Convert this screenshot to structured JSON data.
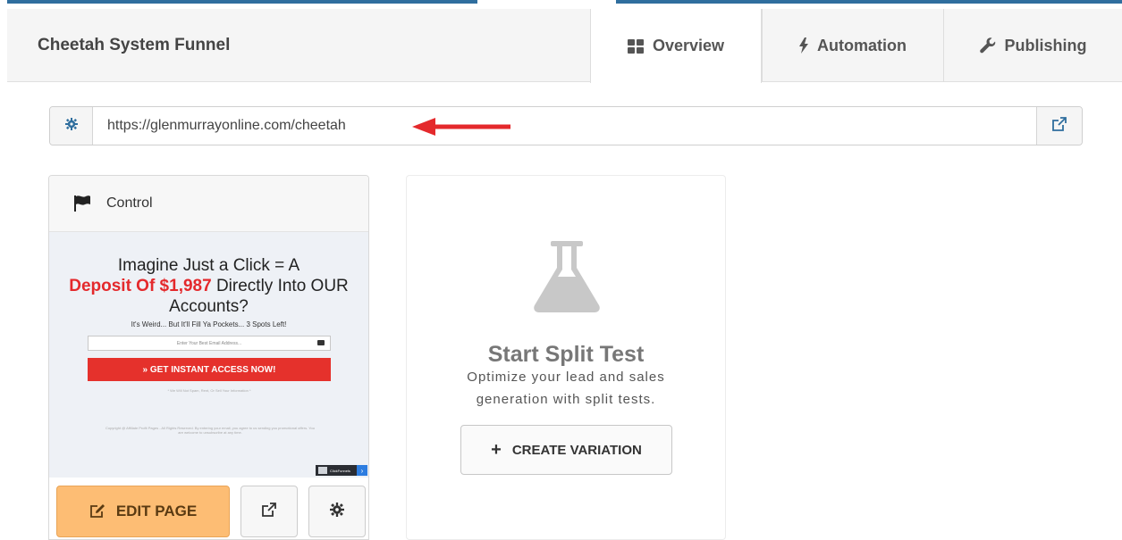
{
  "funnel": {
    "title": "Cheetah System Funnel"
  },
  "tabs": [
    {
      "label": "Overview",
      "icon": "grid-icon",
      "active": true
    },
    {
      "label": "Automation",
      "icon": "bolt-icon",
      "active": false
    },
    {
      "label": "Publishing",
      "icon": "wrench-icon",
      "active": false
    }
  ],
  "url_bar": {
    "url": "https://glenmurrayonline.com/cheetah"
  },
  "control": {
    "label": "Control",
    "preview": {
      "headline_pre": "Imagine Just a Click = A",
      "headline_red": "Deposit Of $1,987",
      "headline_post": "Directly Into OUR Accounts?",
      "subheadline": "It's Weird... But It'll Fill Ya Pockets... 3 Spots Left!",
      "email_placeholder": "Enter Your Best Email Address...",
      "cta": "» GET INSTANT ACCESS NOW!",
      "privacy": "* We Will Not Spam, Rent, Or Sell Your Information *",
      "footer": "Copyright @ Affiliate Profit Pages - All Rights Reserved. By entering your email, you agree to us sending you promotional offers. You are welcome to unsubscribe at any time.",
      "badge": "ClickFunnels"
    },
    "edit_label": "EDIT PAGE"
  },
  "split_test": {
    "title": "Start Split Test",
    "description_line1": "Optimize your lead and sales",
    "description_line2": "generation with split tests.",
    "create_label": "CREATE VARIATION"
  },
  "colors": {
    "accent_line": "#2f6e9e",
    "red_arrow": "#e4292c",
    "edit_button": "#fdbd74",
    "cta_red": "#e5312c",
    "gear_blue": "#2f6e9e"
  }
}
